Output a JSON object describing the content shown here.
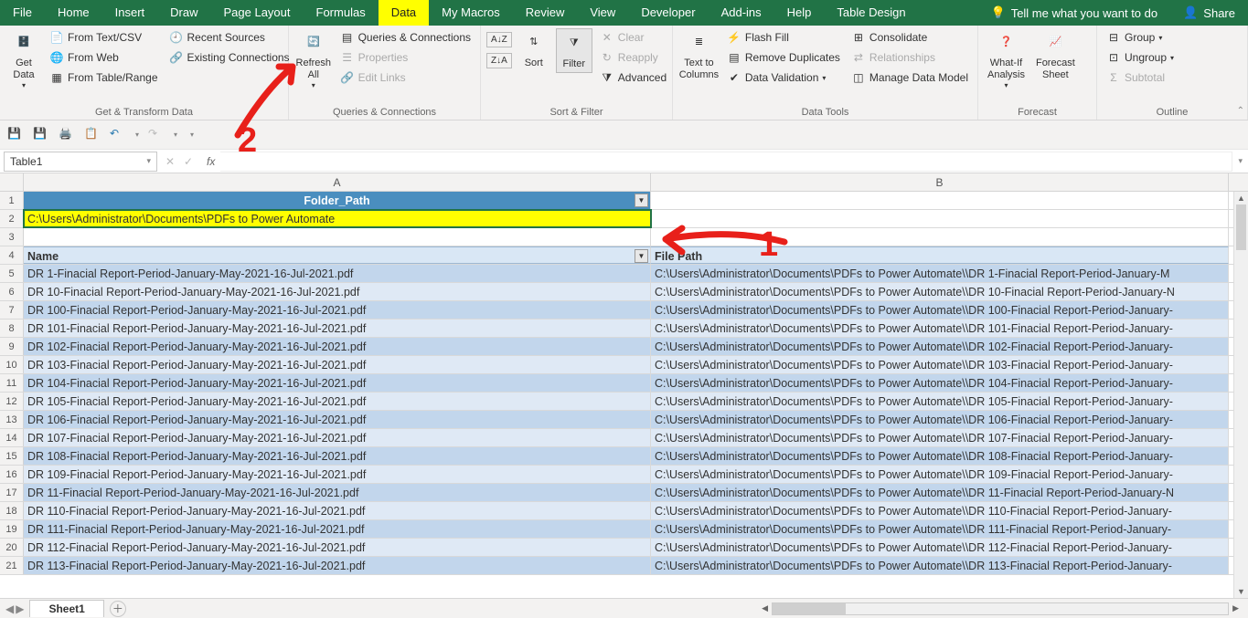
{
  "menubar": {
    "tabs": [
      "File",
      "Home",
      "Insert",
      "Draw",
      "Page Layout",
      "Formulas",
      "Data",
      "My Macros",
      "Review",
      "View",
      "Developer",
      "Add-ins",
      "Help",
      "Table Design"
    ],
    "active": "Data",
    "tellme": "Tell me what you want to do",
    "share": "Share"
  },
  "ribbon": {
    "groups": {
      "getTransform": {
        "label": "Get & Transform Data",
        "getData": "Get\nData",
        "fromTextCsv": "From Text/CSV",
        "fromWeb": "From Web",
        "fromTableRange": "From Table/Range",
        "recentSources": "Recent Sources",
        "existingConnections": "Existing Connections"
      },
      "queries": {
        "label": "Queries & Connections",
        "refreshAll": "Refresh\nAll",
        "queriesConnections": "Queries & Connections",
        "properties": "Properties",
        "editLinks": "Edit Links"
      },
      "sortFilter": {
        "label": "Sort & Filter",
        "sort": "Sort",
        "filter": "Filter",
        "clear": "Clear",
        "reapply": "Reapply",
        "advanced": "Advanced"
      },
      "dataTools": {
        "label": "Data Tools",
        "textToColumns": "Text to\nColumns",
        "flashFill": "Flash Fill",
        "removeDuplicates": "Remove Duplicates",
        "dataValidation": "Data Validation",
        "consolidate": "Consolidate",
        "relationships": "Relationships",
        "manageDataModel": "Manage Data Model"
      },
      "forecast": {
        "label": "Forecast",
        "whatIf": "What-If\nAnalysis",
        "forecastSheet": "Forecast\nSheet"
      },
      "outline": {
        "label": "Outline",
        "group": "Group",
        "ungroup": "Ungroup",
        "subtotal": "Subtotal"
      }
    }
  },
  "namebox": "Table1",
  "columns": {
    "A": "A",
    "B": "B"
  },
  "header1": {
    "A": "Folder_Path"
  },
  "folderPath": "C:\\Users\\Administrator\\Documents\\PDFs to Power Automate",
  "tableHeaders": {
    "name": "Name",
    "filePath": "File Path"
  },
  "rows": [
    {
      "n": 5,
      "name": "DR 1-Finacial Report-Period-January-May-2021-16-Jul-2021.pdf",
      "path": "C:\\Users\\Administrator\\Documents\\PDFs to Power Automate\\\\DR 1-Finacial Report-Period-January-M"
    },
    {
      "n": 6,
      "name": "DR 10-Finacial Report-Period-January-May-2021-16-Jul-2021.pdf",
      "path": "C:\\Users\\Administrator\\Documents\\PDFs to Power Automate\\\\DR 10-Finacial Report-Period-January-N"
    },
    {
      "n": 7,
      "name": "DR 100-Finacial Report-Period-January-May-2021-16-Jul-2021.pdf",
      "path": "C:\\Users\\Administrator\\Documents\\PDFs to Power Automate\\\\DR 100-Finacial Report-Period-January-"
    },
    {
      "n": 8,
      "name": "DR 101-Finacial Report-Period-January-May-2021-16-Jul-2021.pdf",
      "path": "C:\\Users\\Administrator\\Documents\\PDFs to Power Automate\\\\DR 101-Finacial Report-Period-January-"
    },
    {
      "n": 9,
      "name": "DR 102-Finacial Report-Period-January-May-2021-16-Jul-2021.pdf",
      "path": "C:\\Users\\Administrator\\Documents\\PDFs to Power Automate\\\\DR 102-Finacial Report-Period-January-"
    },
    {
      "n": 10,
      "name": "DR 103-Finacial Report-Period-January-May-2021-16-Jul-2021.pdf",
      "path": "C:\\Users\\Administrator\\Documents\\PDFs to Power Automate\\\\DR 103-Finacial Report-Period-January-"
    },
    {
      "n": 11,
      "name": "DR 104-Finacial Report-Period-January-May-2021-16-Jul-2021.pdf",
      "path": "C:\\Users\\Administrator\\Documents\\PDFs to Power Automate\\\\DR 104-Finacial Report-Period-January-"
    },
    {
      "n": 12,
      "name": "DR 105-Finacial Report-Period-January-May-2021-16-Jul-2021.pdf",
      "path": "C:\\Users\\Administrator\\Documents\\PDFs to Power Automate\\\\DR 105-Finacial Report-Period-January-"
    },
    {
      "n": 13,
      "name": "DR 106-Finacial Report-Period-January-May-2021-16-Jul-2021.pdf",
      "path": "C:\\Users\\Administrator\\Documents\\PDFs to Power Automate\\\\DR 106-Finacial Report-Period-January-"
    },
    {
      "n": 14,
      "name": "DR 107-Finacial Report-Period-January-May-2021-16-Jul-2021.pdf",
      "path": "C:\\Users\\Administrator\\Documents\\PDFs to Power Automate\\\\DR 107-Finacial Report-Period-January-"
    },
    {
      "n": 15,
      "name": "DR 108-Finacial Report-Period-January-May-2021-16-Jul-2021.pdf",
      "path": "C:\\Users\\Administrator\\Documents\\PDFs to Power Automate\\\\DR 108-Finacial Report-Period-January-"
    },
    {
      "n": 16,
      "name": "DR 109-Finacial Report-Period-January-May-2021-16-Jul-2021.pdf",
      "path": "C:\\Users\\Administrator\\Documents\\PDFs to Power Automate\\\\DR 109-Finacial Report-Period-January-"
    },
    {
      "n": 17,
      "name": "DR 11-Finacial Report-Period-January-May-2021-16-Jul-2021.pdf",
      "path": "C:\\Users\\Administrator\\Documents\\PDFs to Power Automate\\\\DR 11-Finacial Report-Period-January-N"
    },
    {
      "n": 18,
      "name": "DR 110-Finacial Report-Period-January-May-2021-16-Jul-2021.pdf",
      "path": "C:\\Users\\Administrator\\Documents\\PDFs to Power Automate\\\\DR 110-Finacial Report-Period-January-"
    },
    {
      "n": 19,
      "name": "DR 111-Finacial Report-Period-January-May-2021-16-Jul-2021.pdf",
      "path": "C:\\Users\\Administrator\\Documents\\PDFs to Power Automate\\\\DR 111-Finacial Report-Period-January-"
    },
    {
      "n": 20,
      "name": "DR 112-Finacial Report-Period-January-May-2021-16-Jul-2021.pdf",
      "path": "C:\\Users\\Administrator\\Documents\\PDFs to Power Automate\\\\DR 112-Finacial Report-Period-January-"
    },
    {
      "n": 21,
      "name": "DR 113-Finacial Report-Period-January-May-2021-16-Jul-2021.pdf",
      "path": "C:\\Users\\Administrator\\Documents\\PDFs to Power Automate\\\\DR 113-Finacial Report-Period-January-"
    }
  ],
  "sheet": {
    "name": "Sheet1"
  },
  "annotations": {
    "one": "1",
    "two": "2"
  }
}
